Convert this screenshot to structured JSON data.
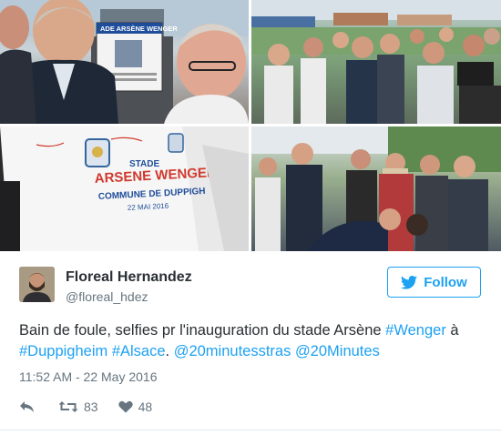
{
  "tweet": {
    "author_name": "Floreal Hernandez",
    "author_handle": "@floreal_hdez",
    "follow_label": "Follow",
    "text_parts": [
      {
        "text": "Bain de foule, selfies pr l'inauguration du stade Arsène ",
        "link": false
      },
      {
        "text": "#Wenger",
        "link": true
      },
      {
        "text": " à ",
        "link": false
      },
      {
        "text": "#Duppigheim",
        "link": true
      },
      {
        "text": " ",
        "link": false
      },
      {
        "text": "#Alsace",
        "link": true
      },
      {
        "text": ". ",
        "link": false
      },
      {
        "text": "@20minutesstras",
        "link": true
      },
      {
        "text": " ",
        "link": false
      },
      {
        "text": "@20Minutes",
        "link": true
      }
    ],
    "timestamp": "11:52 AM - 22 May 2016",
    "retweet_count": "83",
    "like_count": "48"
  },
  "photos": {
    "sign_text": "ADE ARSÈNE WENGER",
    "shirt_line1": "STADE",
    "shirt_line2": "ARSENE WENGER",
    "shirt_line3": "COMMUNE DE DUPPIGH",
    "shirt_line4": "22 MAI 2016"
  },
  "icons": {
    "follow": "twitter-bird-icon",
    "reply": "reply-icon",
    "retweet": "retweet-icon",
    "like": "heart-icon"
  },
  "colors": {
    "accent": "#1da1f2",
    "text": "#292f33",
    "muted": "#66757f"
  }
}
